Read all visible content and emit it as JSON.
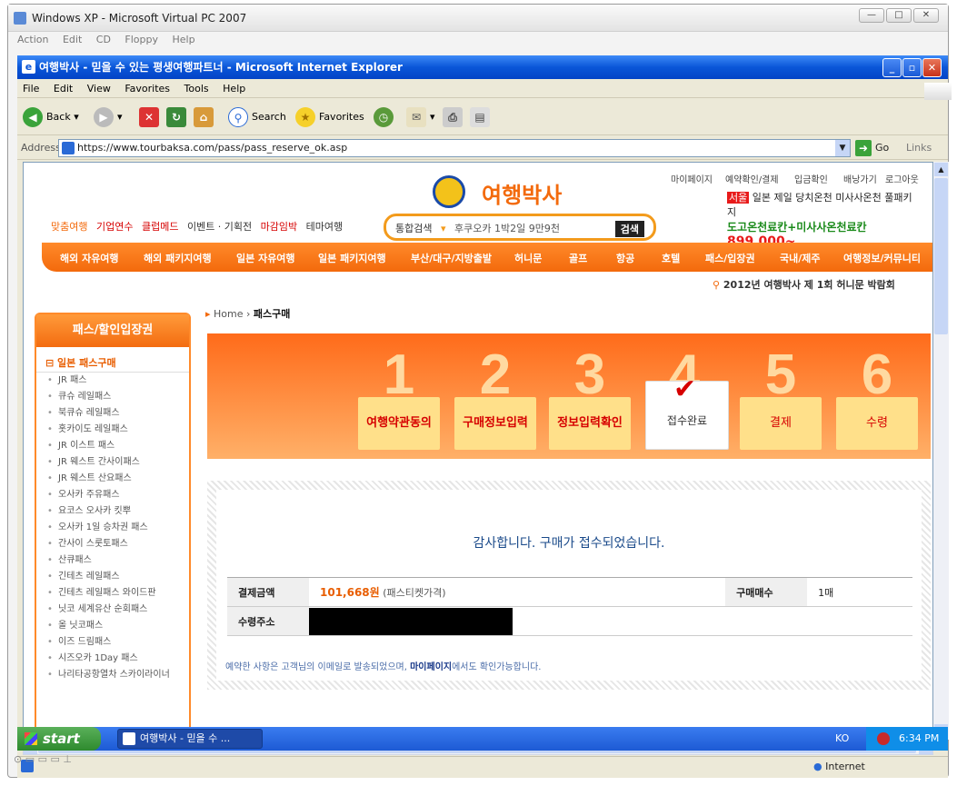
{
  "vpc": {
    "title": "Windows XP - Microsoft Virtual PC 2007",
    "menu": [
      "Action",
      "Edit",
      "CD",
      "Floppy",
      "Help"
    ]
  },
  "ie": {
    "title": "여행박사 - 믿을 수 있는 평생여행파트너 - Microsoft Internet Explorer",
    "menu": [
      "File",
      "Edit",
      "View",
      "Favorites",
      "Tools",
      "Help"
    ],
    "toolbar": {
      "back": "Back",
      "search": "Search",
      "favorites": "Favorites"
    },
    "address_label": "Address",
    "url": "https://www.tourbaksa.com/pass/pass_reserve_ok.asp",
    "go": "Go",
    "links": "Links",
    "status_zone": "Internet"
  },
  "site": {
    "logo": "여행박사",
    "top_links": [
      "마이페이지",
      "예약확인/결제",
      "입금확인",
      "배낭가기",
      "로그아웃"
    ],
    "top_nav": [
      "맞춤여행",
      "기업연수",
      "클럽메드",
      "이벤트 · 기획전",
      "마감임박",
      "테마여행"
    ],
    "search": {
      "label": "통합검색",
      "query": "후쿠오카 1박2일 9만9천",
      "button": "검색"
    },
    "banner": {
      "tag": "서울",
      "line1": "일본 제일 당치온천 미사사온천 풀패키지",
      "line2": "도고온천료칸+미사사온천료칸",
      "price": "899,000~"
    },
    "categories": [
      "해외 자유여행",
      "해외 패키지여행",
      "일본 자유여행",
      "일본 패키지여행",
      "부산/대구/지방출발",
      "허니문",
      "골프",
      "항공",
      "호텔",
      "패스/입장권",
      "국내/제주",
      "여행정보/커뮤니티"
    ],
    "promo": "2012년 여행박사 제 1회 허니문 박람회"
  },
  "sidebar": {
    "title": "패스/할인입장권",
    "section": "일본 패스구매",
    "items": [
      "JR 패스",
      "큐슈 레일패스",
      "북큐슈 레일패스",
      "홋카이도 레일패스",
      "JR 이스트 패스",
      "JR 웨스트 간사이패스",
      "JR 웨스트 산요패스",
      "오사카 주유패스",
      "요코스 오사카 킷뿌",
      "오사카 1일 승차권 패스",
      "간사이 스룻토패스",
      "산큐패스",
      "긴테츠 레일패스",
      "긴테츠 레일패스 와이드판",
      "닛코 세계유산 순회패스",
      "올 닛코패스",
      "이즈 드림패스",
      "시즈오카 1Day 패스",
      "나리타공항열차 스카이라이너"
    ]
  },
  "breadcrumb": {
    "home": "Home",
    "current": "패스구매"
  },
  "steps": [
    {
      "num": "1",
      "label": "여행약관동의"
    },
    {
      "num": "2",
      "label": "구매정보입력"
    },
    {
      "num": "3",
      "label": "정보입력확인"
    },
    {
      "num": "4",
      "label": "접수완료"
    },
    {
      "num": "5",
      "label": "결제"
    },
    {
      "num": "6",
      "label": "수령"
    }
  ],
  "result": {
    "thanks": "감사합니다. 구매가 접수되었습니다.",
    "amount_label": "결제금액",
    "amount": "101,668원",
    "amount_note": "(패스티켓가격)",
    "qty_label": "구매매수",
    "qty": "1매",
    "address_label": "수령주소",
    "note_prefix": "예약한 사항은 고객님의 이메일로 발송되었으며,",
    "note_link": "마이페이지",
    "note_suffix": "에서도 확인가능합니다."
  },
  "taskbar": {
    "start": "start",
    "task": "여행박사 - 믿을 수 ...",
    "lang": "KO",
    "time": "6:34 PM"
  },
  "colors": {
    "accent": "#f36a0c",
    "xp_blue": "#0a56d8"
  }
}
